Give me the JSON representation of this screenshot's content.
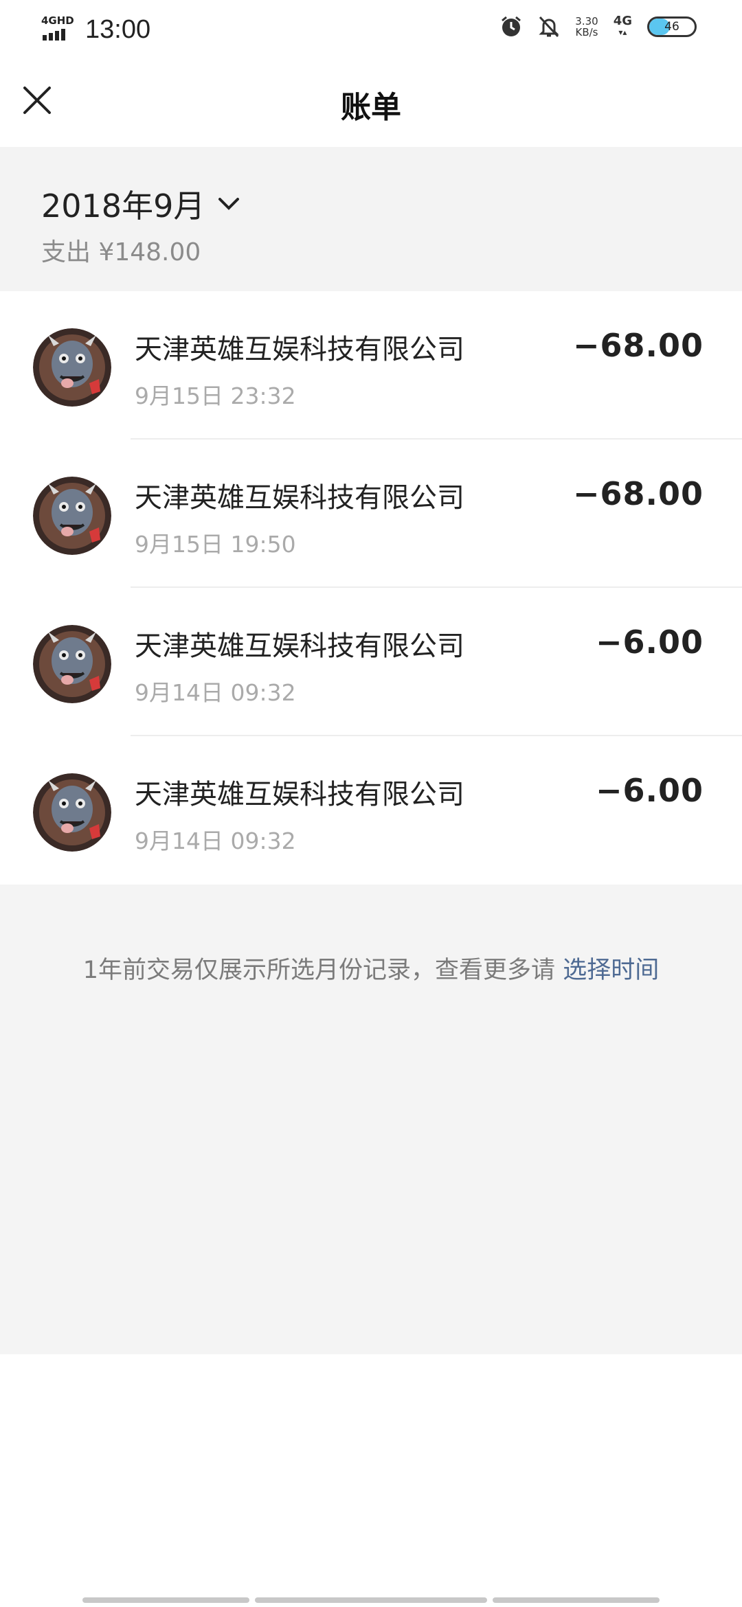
{
  "status_bar": {
    "network_label": "4GHD",
    "time": "13:00",
    "speed_value": "3.30",
    "speed_unit": "KB/s",
    "cell_label": "4G",
    "battery_level": 46,
    "battery_text": "46"
  },
  "header": {
    "title": "账单",
    "close_icon": "close-icon"
  },
  "summary": {
    "month": "2018年9月",
    "expense": "支出 ¥148.00",
    "dropdown_icon": "chevron-down-icon"
  },
  "transactions": [
    {
      "merchant": "天津英雄互娱科技有限公司",
      "time": "9月15日 23:32",
      "amount": "−68.00"
    },
    {
      "merchant": "天津英雄互娱科技有限公司",
      "time": "9月15日 19:50",
      "amount": "−68.00"
    },
    {
      "merchant": "天津英雄互娱科技有限公司",
      "time": "9月14日 09:32",
      "amount": "−6.00"
    },
    {
      "merchant": "天津英雄互娱科技有限公司",
      "time": "9月14日 09:32",
      "amount": "−6.00"
    }
  ],
  "notice": {
    "text": "1年前交易仅展示所选月份记录，查看更多请",
    "link": "选择时间"
  },
  "colors": {
    "link": "#4e6a93",
    "summary_bg": "#f3f3f3",
    "battery_fill": "#5bc6f0"
  }
}
